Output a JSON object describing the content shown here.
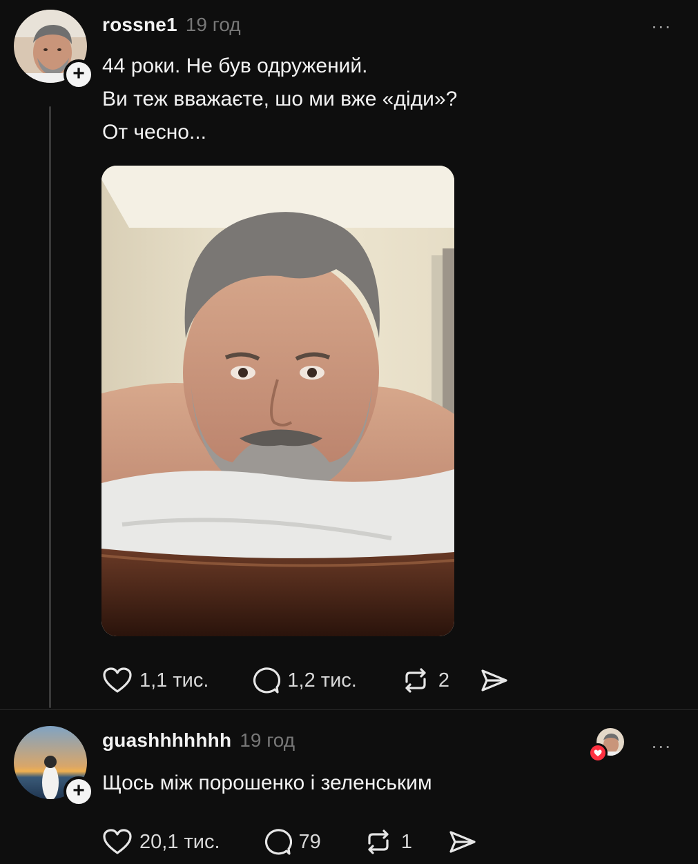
{
  "post1": {
    "username": "rossne1",
    "time": "19 год",
    "more": "...",
    "lines": [
      "44 роки. Не був одружений.",
      "Ви теж вважаєте, шо ми вже «діди»?",
      "От чесно..."
    ],
    "likes": "1,1 тис.",
    "replies": "1,2 тис.",
    "reposts": "2"
  },
  "post2": {
    "username": "guashhhhhhh",
    "time": "19 год",
    "more": "...",
    "text": "Щось між порошенко і зеленським",
    "likes": "20,1 тис.",
    "replies": "79",
    "reposts": "1"
  },
  "follow_symbol": "+",
  "icons": [
    "heart-icon",
    "comment-icon",
    "repost-icon",
    "share-icon",
    "plus-icon",
    "more-icon"
  ],
  "colors": {
    "background": "#0e0e0e",
    "text": "#f2f2f2",
    "muted": "#777777",
    "heart": "#ff3040"
  }
}
